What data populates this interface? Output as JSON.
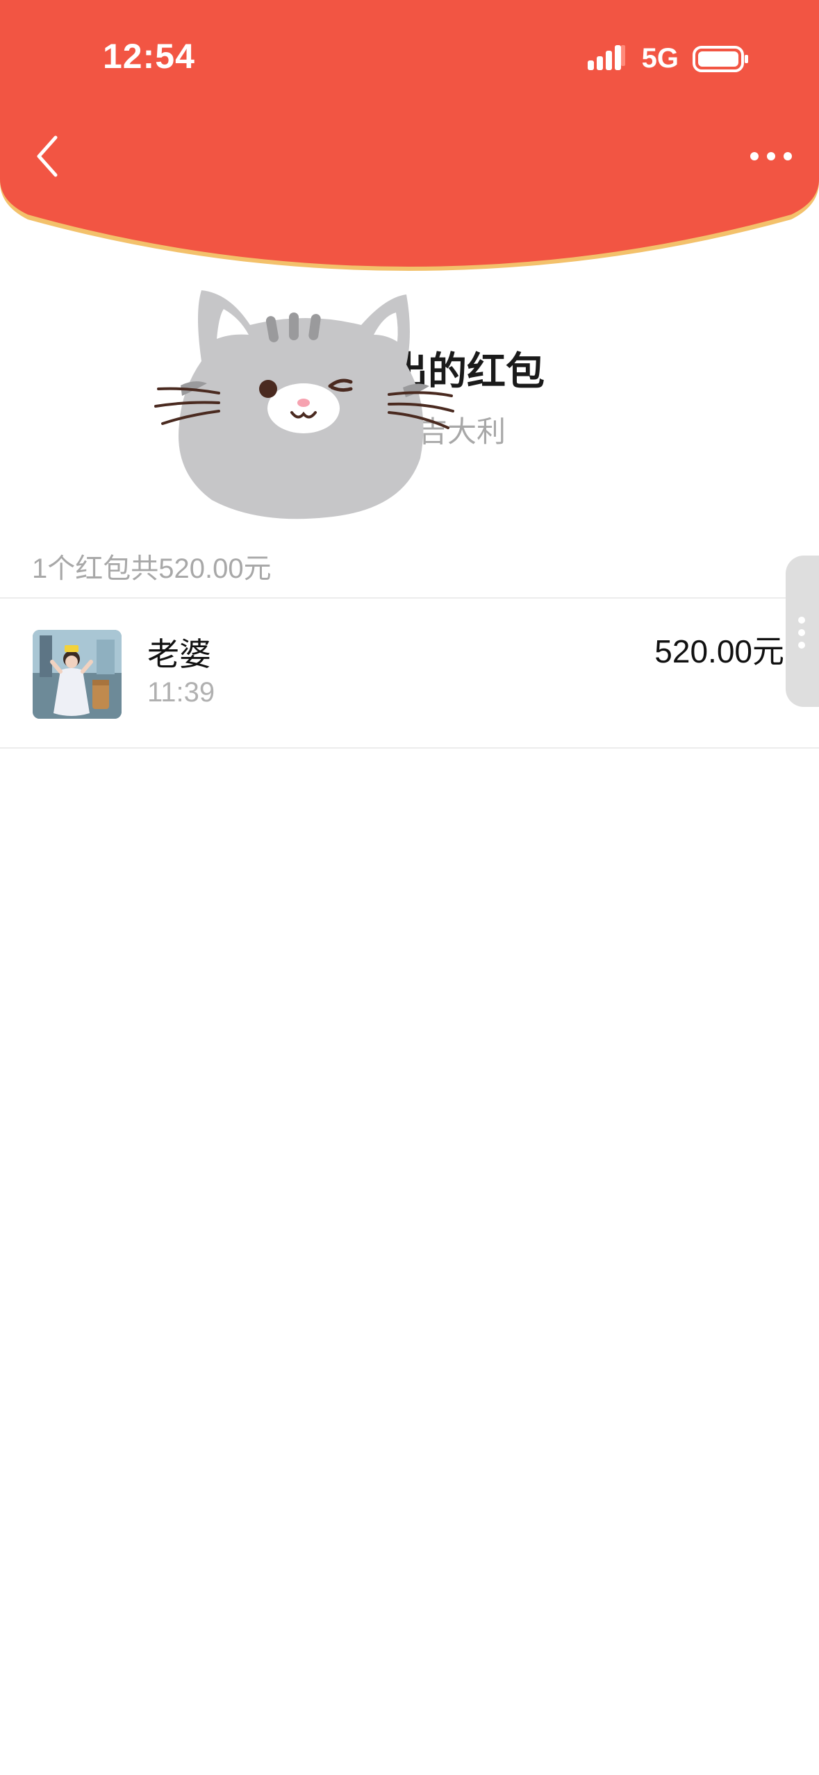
{
  "colors": {
    "header_red": "#F25543",
    "header_edge_gold": "#F3C16B",
    "title_text": "#1a1a1a",
    "muted_text": "#a8a8a8"
  },
  "status_bar": {
    "time": "12:54",
    "network": "5G",
    "icons": [
      "signal-icon",
      "battery-icon"
    ]
  },
  "nav": {
    "icons": [
      "back-chevron-icon",
      "more-dots-icon"
    ]
  },
  "sticker": {
    "icon": "winking-cat-sticker"
  },
  "header_card": {
    "title_visible": "出的红包",
    "blessing_visible": "吉大利"
  },
  "summary": {
    "text": "1个红包共520.00元"
  },
  "records": [
    {
      "name": "老婆",
      "time": "11:39",
      "amount": "520.00元"
    }
  ]
}
